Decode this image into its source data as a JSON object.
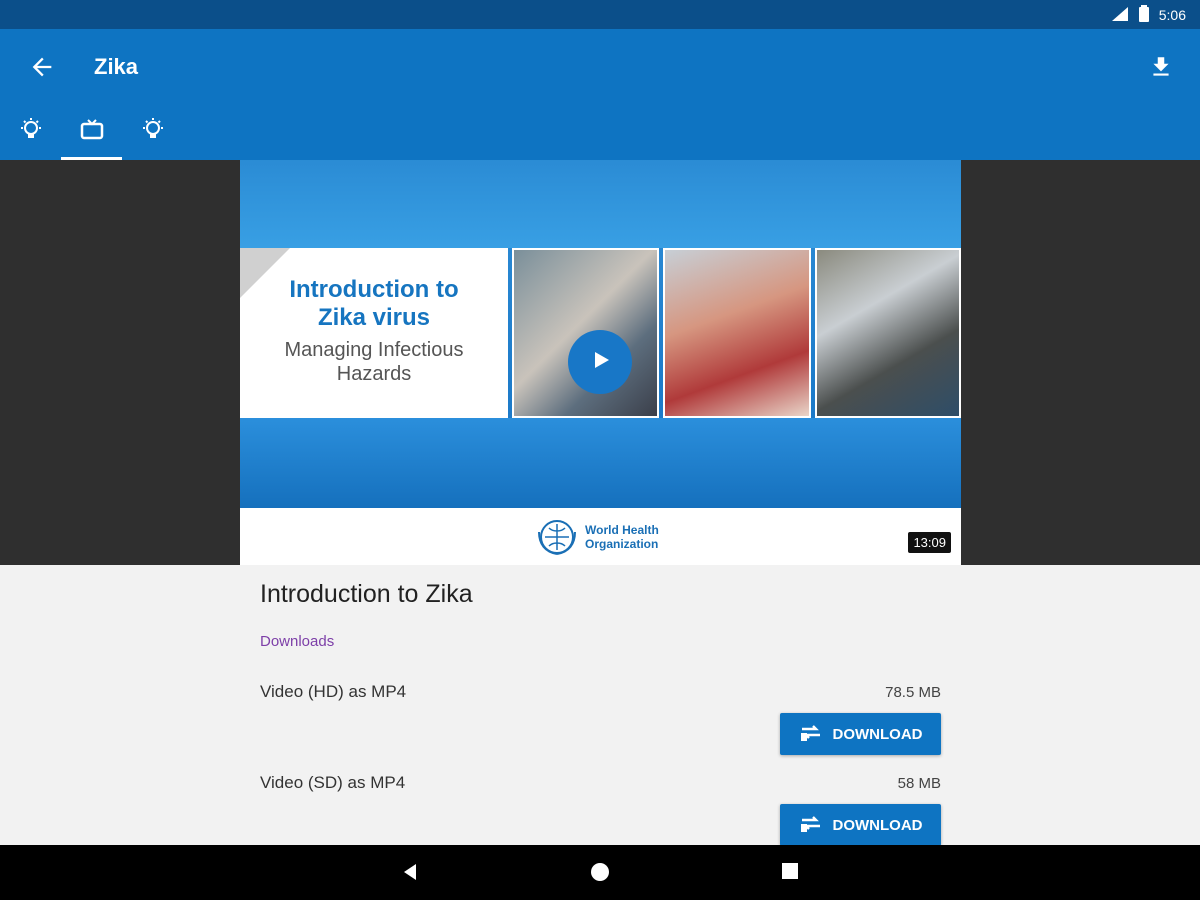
{
  "status_bar": {
    "time": "5:06"
  },
  "app_bar": {
    "title": "Zika",
    "tabs": [
      "lightbulb-icon",
      "tv-icon",
      "lightbulb-icon"
    ],
    "active_tab": 1
  },
  "video": {
    "card_title": "Introduction to Zika virus",
    "card_subtitle": "Managing Infectious Hazards",
    "org_line1": "World Health",
    "org_line2": "Organization",
    "duration": "13:09"
  },
  "main": {
    "title": "Introduction to Zika",
    "section_label": "Downloads",
    "downloads": [
      {
        "label": "Video (HD) as MP4",
        "size": "78.5 MB",
        "button": "DOWNLOAD"
      },
      {
        "label": "Video (SD) as MP4",
        "size": "58 MB",
        "button": "DOWNLOAD"
      }
    ]
  },
  "colors": {
    "status_bar": "#0b4f8a",
    "app_bar": "#0e74c2",
    "accent_label": "#7d3fa8"
  }
}
